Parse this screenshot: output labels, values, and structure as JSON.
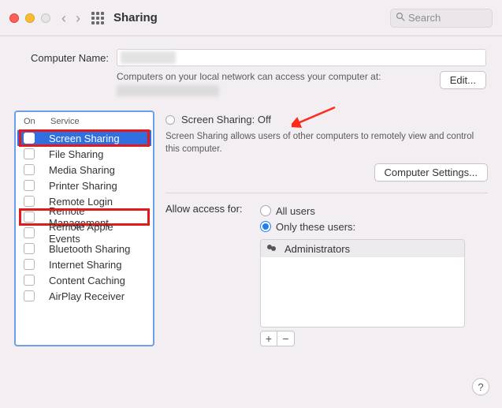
{
  "titlebar": {
    "title": "Sharing",
    "search_placeholder": "Search"
  },
  "computer_name": {
    "label": "Computer Name:",
    "subtext": "Computers on your local network can access your computer at:",
    "edit_button": "Edit..."
  },
  "service_header": {
    "on": "On",
    "service": "Service"
  },
  "services": [
    {
      "label": "Screen Sharing",
      "selected": true,
      "highlighted": true
    },
    {
      "label": "File Sharing"
    },
    {
      "label": "Media Sharing"
    },
    {
      "label": "Printer Sharing"
    },
    {
      "label": "Remote Login"
    },
    {
      "label": "Remote Management",
      "highlighted": true
    },
    {
      "label": "Remote Apple Events"
    },
    {
      "label": "Bluetooth Sharing"
    },
    {
      "label": "Internet Sharing"
    },
    {
      "label": "Content Caching"
    },
    {
      "label": "AirPlay Receiver"
    }
  ],
  "detail": {
    "status_prefix": "Screen Sharing:",
    "status_value": "Off",
    "description": "Screen Sharing allows users of other computers to remotely view and control this computer.",
    "computer_settings_button": "Computer Settings...",
    "access_label": "Allow access for:",
    "opt_all": "All users",
    "opt_only": "Only these users:",
    "access_selected": "only",
    "users": [
      "Administrators"
    ],
    "plus": "+",
    "minus": "−"
  },
  "help": "?"
}
